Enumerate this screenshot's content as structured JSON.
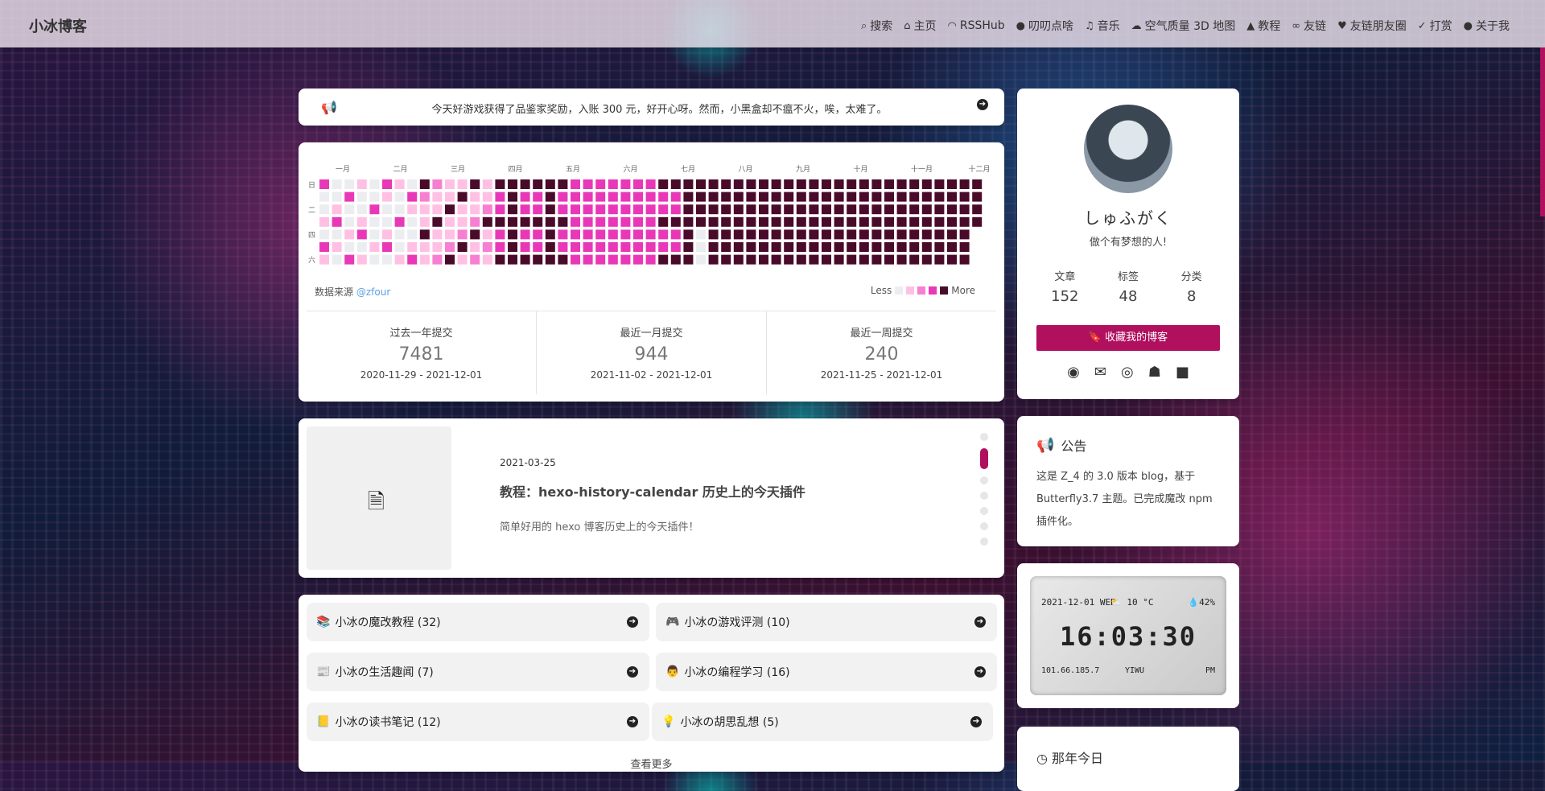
{
  "nav": {
    "brand": "小冰博客",
    "items": [
      {
        "icon": "search-icon",
        "glyph": "⌕",
        "label": "搜索"
      },
      {
        "icon": "home-icon",
        "glyph": "⌂",
        "label": "主页"
      },
      {
        "icon": "rss-icon",
        "glyph": "◠",
        "label": "RSSHub"
      },
      {
        "icon": "comment-icon",
        "glyph": "●",
        "label": "叨叨点啥"
      },
      {
        "icon": "music-icon",
        "glyph": "♫",
        "label": "音乐"
      },
      {
        "icon": "cloud-icon",
        "glyph": "☁",
        "label": "空气质量 3D 地图"
      },
      {
        "icon": "graduation-cap-icon",
        "glyph": "▲",
        "label": "教程"
      },
      {
        "icon": "link-icon",
        "glyph": "∞",
        "label": "友链"
      },
      {
        "icon": "heart-icon",
        "glyph": "♥",
        "label": "友链朋友圈"
      },
      {
        "icon": "thumbs-up-icon",
        "glyph": "✓",
        "label": "打赏"
      },
      {
        "icon": "lightbulb-icon",
        "glyph": "●",
        "label": "关于我"
      }
    ]
  },
  "notice": {
    "text": "今天好游戏获得了品鉴家奖励，入账 300 元，好开心呀。然而，小黑盒却不瘟不火，唉，太难了。"
  },
  "calendar": {
    "months": [
      "一月",
      "二月",
      "三月",
      "四月",
      "五月",
      "六月",
      "七月",
      "八月",
      "九月",
      "十月",
      "十一月",
      "十二月"
    ],
    "weekdays": [
      "日",
      "二",
      "四",
      "六"
    ],
    "source_label": "数据来源",
    "source_link": "@zfour",
    "legend_less": "Less",
    "legend_more": "More",
    "colors": [
      "#ebedf0",
      "#ffc0e3",
      "#f77fd2",
      "#e838b8",
      "#a1124e",
      "#4a0a2a"
    ],
    "stats": [
      {
        "label": "过去一年提交",
        "value": "7481",
        "range": "2020-11-29 - 2021-12-01"
      },
      {
        "label": "最近一月提交",
        "value": "944",
        "range": "2021-11-02 - 2021-12-01"
      },
      {
        "label": "最近一周提交",
        "value": "240",
        "range": "2021-11-25 - 2021-12-01"
      }
    ]
  },
  "history_post": {
    "date": "2021-03-25",
    "title": "教程：hexo-history-calendar 历史上的今天插件",
    "desc": "简单好用的 hexo 博客历史上的今天插件！"
  },
  "categories": [
    {
      "icon": "📚",
      "label": "小冰の魔改教程 (32)"
    },
    {
      "icon": "🎮",
      "label": "小冰の游戏评测 (10)"
    },
    {
      "icon": "📰",
      "label": "小冰の生活趣闻 (7)"
    },
    {
      "icon": "👨",
      "label": "小冰の编程学习 (16)"
    },
    {
      "icon": "📒",
      "label": "小冰の读书笔记 (12)"
    },
    {
      "icon": "💡",
      "label": "小冰の胡思乱想 (5)"
    }
  ],
  "categories_more": "查看更多",
  "profile": {
    "name": "しゅふがく",
    "desc": "做个有梦想的人!",
    "stats": [
      {
        "label": "文章",
        "value": "152"
      },
      {
        "label": "标签",
        "value": "48"
      },
      {
        "label": "分类",
        "value": "8"
      }
    ],
    "bookmark_label": "收藏我的博客"
  },
  "announcement": {
    "title": "公告",
    "body": "这是 Z_4 的 3.0 版本 blog，基于 Butterfly3.7 主题。已完成魔改 npm 插件化。"
  },
  "clock": {
    "date": "2021-12-01 WED",
    "temp": "10 °C",
    "humidity": "42%",
    "time": "16:03:30",
    "ip": "101.66.185.7",
    "city": "YIWU",
    "ampm": "PM"
  },
  "history_today": {
    "title": "那年今日"
  }
}
